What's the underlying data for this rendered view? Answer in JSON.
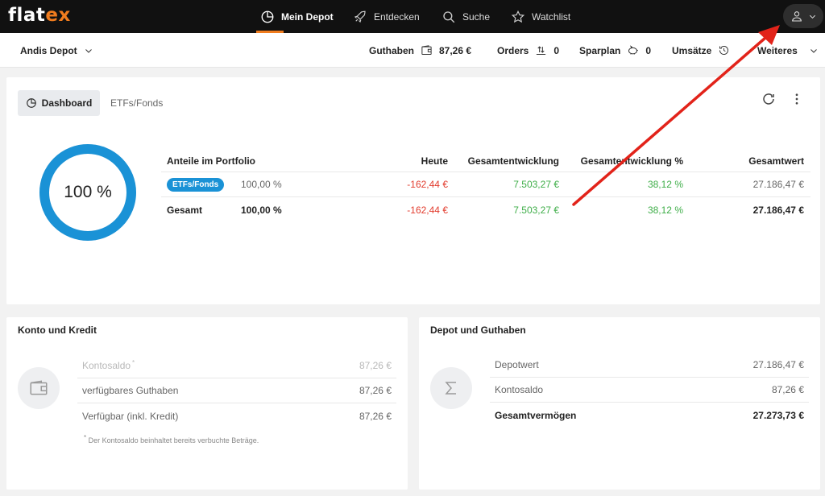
{
  "topbar": {
    "logo_main": "flat",
    "logo_accent": "ex",
    "nav": [
      {
        "label": "Mein Depot",
        "icon": "pie-chart-icon",
        "active": true
      },
      {
        "label": "Entdecken",
        "icon": "rocket-icon",
        "active": false
      },
      {
        "label": "Suche",
        "icon": "search-icon",
        "active": false
      },
      {
        "label": "Watchlist",
        "icon": "star-icon",
        "active": false
      }
    ],
    "user_icon": "user-icon",
    "accent_color": "#f07c1e"
  },
  "subbar": {
    "depot_name": "Andis Depot",
    "guthaben_label": "Guthaben",
    "guthaben_value": "87,26 €",
    "orders_label": "Orders",
    "orders_count": "0",
    "sparplan_label": "Sparplan",
    "sparplan_count": "0",
    "umsaetze_label": "Umsätze",
    "weiteres_label": "Weiteres"
  },
  "dashboard": {
    "tab_dashboard": "Dashboard",
    "tab_etf": "ETFs/Fonds",
    "donut_label": "100 %",
    "donut_share": 1.0,
    "donut_color": "#1a92d6",
    "table": {
      "headers": {
        "name": "Anteile im Portfolio",
        "today": "Heute",
        "dev": "Gesamtentwicklung",
        "dev_pct": "Gesamtentwicklung %",
        "total": "Gesamtwert"
      },
      "rows": [
        {
          "name": "ETFs/Fonds",
          "pct": "100,00 %",
          "today": "-162,44 €",
          "dev": "7.503,27 €",
          "dev_pct": "38,12 %",
          "total": "27.186,47 €"
        },
        {
          "name": "Gesamt",
          "pct": "100,00 %",
          "today": "-162,44 €",
          "dev": "7.503,27 €",
          "dev_pct": "38,12 %",
          "total": "27.186,47 €"
        }
      ]
    }
  },
  "konto": {
    "title": "Konto und Kredit",
    "icon": "wallet-icon",
    "rows": [
      {
        "label": "Kontosaldo",
        "sup": "*",
        "value": "87,26 €"
      },
      {
        "label": "verfügbares Guthaben",
        "value": "87,26 €"
      },
      {
        "label": "Verfügbar (inkl. Kredit)",
        "value": "87,26 €"
      }
    ],
    "footnote_mark": "*",
    "footnote": "Der Kontosaldo beinhaltet bereits verbuchte Beträge."
  },
  "depot": {
    "title": "Depot und Guthaben",
    "icon": "sigma-icon",
    "rows": [
      {
        "label": "Depotwert",
        "value": "27.186,47 €"
      },
      {
        "label": "Kontosaldo",
        "value": "87,26 €"
      },
      {
        "label": "Gesamtvermögen",
        "value": "27.273,73 €"
      }
    ]
  },
  "colors": {
    "negative": "#e23c2e",
    "positive": "#3fae49",
    "arrow": "#e2231a"
  }
}
